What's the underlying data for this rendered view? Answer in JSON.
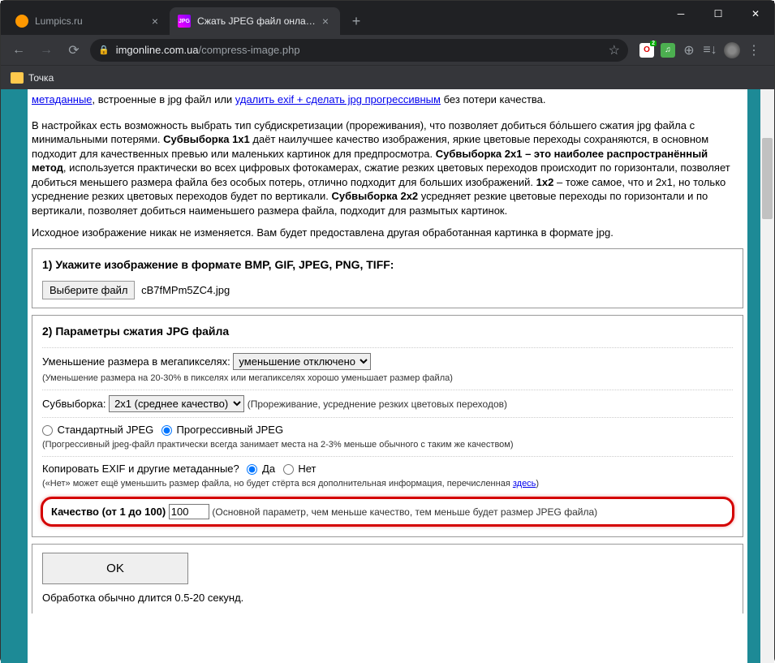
{
  "tabs": [
    {
      "title": "Lumpics.ru"
    },
    {
      "title": "Сжать JPEG файл онлайн - IMG"
    }
  ],
  "url": {
    "host": "imgonline.com.ua",
    "path": "/compress-image.php"
  },
  "bookmark": {
    "label": "Точка"
  },
  "intro": {
    "link1": "метаданные",
    "text1": ", встроенные в jpg файл или ",
    "link2": "удалить exif + сделать jpg прогрессивным",
    "text2": " без потери качества."
  },
  "para2": "В настройках есть возможность выбрать тип субдискретизации (прореживания), что позволяет добиться бо́льшего сжатия jpg файла с минимальными потерями. ",
  "para2b": "Субвыборка 1x1",
  "para2c": " даёт наилучшее качество изображения, яркие цветовые переходы сохраняются, в основном подходит для качественных превью или маленьких картинок для предпросмотра. ",
  "para2d": "Субвыборка 2x1 – это наиболее распространённый метод",
  "para2e": ", используется практически во всех цифровых фотокамерах, сжатие резких цветовых переходов происходит по горизонтали, позволяет добиться меньшего размера файла без особых потерь, отлично подходит для больших изображений. ",
  "para2f": "1x2",
  "para2g": " – тоже самое, что и 2x1, но только усреднение резких цветовых переходов будет по вертикали. ",
  "para2h": "Субвыборка 2x2",
  "para2i": " усредняет резкие цветовые переходы по горизонтали и по вертикали, позволяет добиться наименьшего размера файла, подходит для размытых картинок.",
  "para3": "Исходное изображение никак не изменяется. Вам будет предоставлена другая обработанная картинка в формате jpg.",
  "section1": {
    "title": "1) Укажите изображение в формате BMP, GIF, JPEG, PNG, TIFF:",
    "button": "Выберите файл",
    "filename": "cB7fMPm5ZC4.jpg"
  },
  "section2": {
    "title": "2) Параметры сжатия JPG файла",
    "megapixel_label": "Уменьшение размера в мегапикселях:",
    "megapixel_value": "уменьшение отключено",
    "megapixel_hint": "(Уменьшение размера на 20-30% в пикселях или мегапикселях хорошо уменьшает размер файла)",
    "subsample_label": "Субвыборка:",
    "subsample_value": "2x1 (среднее качество)",
    "subsample_hint": "(Прореживание, усреднение резких цветовых переходов)",
    "jpeg_standard": "Стандартный JPEG",
    "jpeg_progressive": "Прогрессивный JPEG",
    "jpeg_hint": "(Прогрессивный jpeg-файл практически всегда занимает места на 2-3% меньше обычного с таким же качеством)",
    "exif_label": "Копировать EXIF и другие метаданные?",
    "exif_yes": "Да",
    "exif_no": "Нет",
    "exif_hint1": "(«Нет» может ещё уменьшить размер файла, но будет стёрта вся дополнительная информация, перечисленная ",
    "exif_hint_link": "здесь",
    "exif_hint2": ")",
    "quality_label": "Качество (от 1 до 100)",
    "quality_value": "100",
    "quality_hint": "(Основной параметр, чем меньше качество, тем меньше будет размер JPEG файла)"
  },
  "section3": {
    "ok": "OK",
    "processing": "Обработка обычно длится 0.5-20 секунд."
  }
}
